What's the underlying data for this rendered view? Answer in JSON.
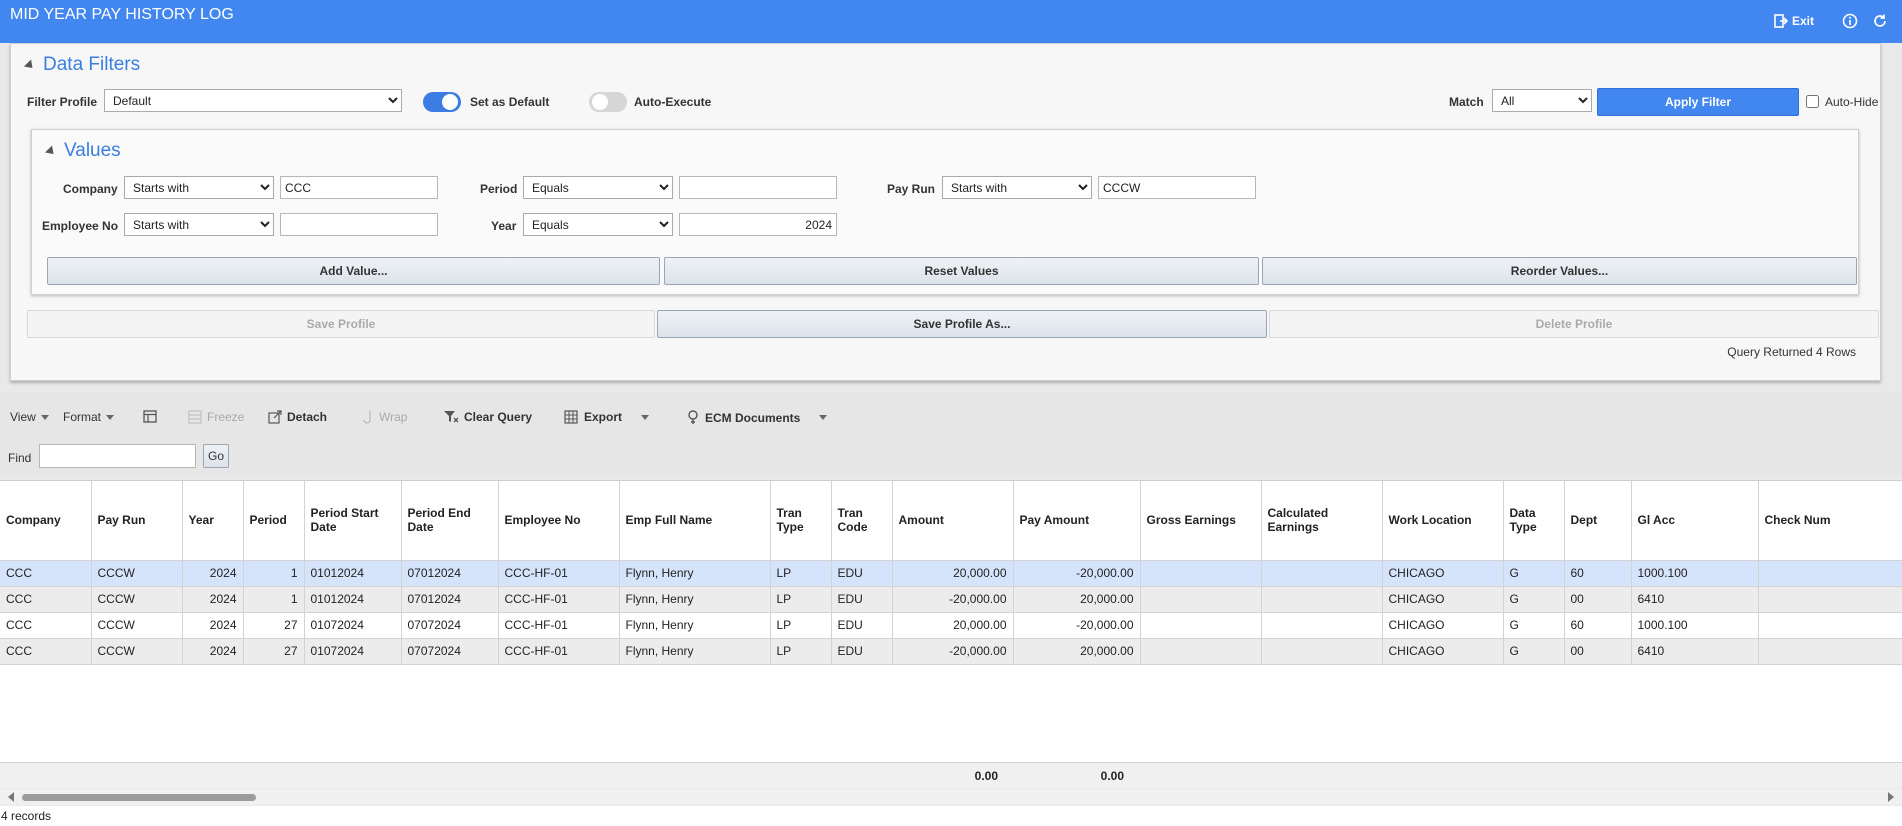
{
  "window": {
    "title": "MID YEAR PAY HISTORY LOG",
    "exit_label": "Exit"
  },
  "filters": {
    "section_title": "Data Filters",
    "profile_label": "Filter Profile",
    "profile_value": "Default",
    "set_default_label": "Set as Default",
    "set_default_on": true,
    "auto_execute_label": "Auto-Execute",
    "auto_execute_on": false,
    "match_label": "Match",
    "match_value": "All",
    "apply_label": "Apply Filter",
    "auto_hide_label": "Auto-Hide",
    "values": {
      "section_title": "Values",
      "company_label": "Company",
      "company_op": "Starts with",
      "company_value": "CCC",
      "period_label": "Period",
      "period_op": "Equals",
      "period_value": "",
      "pay_run_label": "Pay Run",
      "pay_run_op": "Starts with",
      "pay_run_value": "CCCW",
      "employee_label": "Employee No",
      "employee_op": "Starts with",
      "employee_value": "",
      "year_label": "Year",
      "year_op": "Equals",
      "year_value": "2024",
      "add_value_label": "Add Value...",
      "reset_values_label": "Reset Values",
      "reorder_values_label": "Reorder Values..."
    },
    "save_profile_label": "Save Profile",
    "save_profile_as_label": "Save Profile As...",
    "delete_profile_label": "Delete Profile",
    "query_result": "Query Returned 4 Rows"
  },
  "toolbar": {
    "view": "View",
    "format": "Format",
    "freeze": "Freeze",
    "detach": "Detach",
    "wrap": "Wrap",
    "clear_query": "Clear Query",
    "export": "Export",
    "ecm": "ECM Documents",
    "find_label": "Find",
    "find_value": "",
    "go": "Go"
  },
  "grid": {
    "headers": [
      "Company",
      "Pay Run",
      "Year",
      "Period",
      "Period Start Date",
      "Period End Date",
      "Employee No",
      "Emp Full Name",
      "Tran Type",
      "Tran Code",
      "Amount",
      "Pay Amount",
      "Gross Earnings",
      "Calculated Earnings",
      "Work Location",
      "Data Type",
      "Dept",
      "Gl Acc",
      "Check Num"
    ],
    "rows": [
      [
        "CCC",
        "CCCW",
        "2024",
        "1",
        "01012024",
        "07012024",
        "CCC-HF-01",
        "Flynn, Henry",
        "LP",
        "EDU",
        "20,000.00",
        "-20,000.00",
        "",
        "",
        "CHICAGO",
        "G",
        "60",
        "1000.100",
        ""
      ],
      [
        "CCC",
        "CCCW",
        "2024",
        "1",
        "01012024",
        "07012024",
        "CCC-HF-01",
        "Flynn, Henry",
        "LP",
        "EDU",
        "-20,000.00",
        "20,000.00",
        "",
        "",
        "CHICAGO",
        "G",
        "00",
        "6410",
        ""
      ],
      [
        "CCC",
        "CCCW",
        "2024",
        "27",
        "01072024",
        "07072024",
        "CCC-HF-01",
        "Flynn, Henry",
        "LP",
        "EDU",
        "20,000.00",
        "-20,000.00",
        "",
        "",
        "CHICAGO",
        "G",
        "60",
        "1000.100",
        ""
      ],
      [
        "CCC",
        "CCCW",
        "2024",
        "27",
        "01072024",
        "07072024",
        "CCC-HF-01",
        "Flynn, Henry",
        "LP",
        "EDU",
        "-20,000.00",
        "20,000.00",
        "",
        "",
        "CHICAGO",
        "G",
        "00",
        "6410",
        ""
      ]
    ],
    "totals": {
      "amount": "0.00",
      "pay_amount": "0.00"
    },
    "record_count": "4 records"
  },
  "colors": {
    "accent": "#4286f0",
    "selected_row": "#d6e4fb",
    "alt_row": "#ececec"
  }
}
